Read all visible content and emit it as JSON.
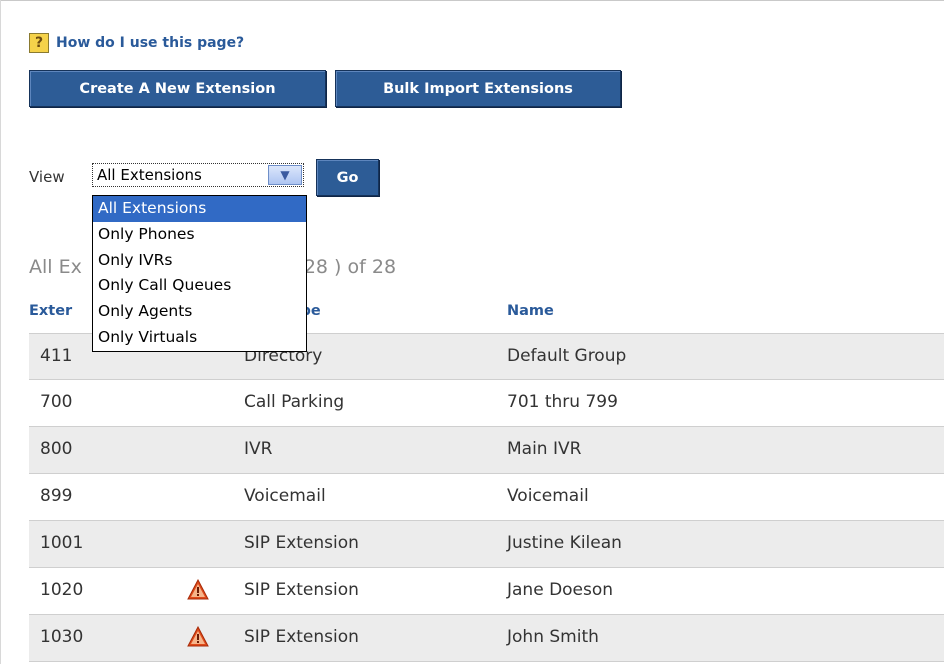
{
  "help": {
    "icon": "help-question-icon",
    "icon_glyph": "?",
    "link_text": "How do I use this page?"
  },
  "toolbar": {
    "create_label": "Create A New Extension",
    "bulk_label": "Bulk Import Extensions"
  },
  "filter": {
    "view_label": "View",
    "selected": "All Extensions",
    "go_label": "Go",
    "options": [
      "All Extensions",
      "Only Phones",
      "Only IVRs",
      "Only Call Queues",
      "Only Agents",
      "Only Virtuals"
    ]
  },
  "summary": {
    "prefix": "All Ex",
    "suffix": "28 ) of 28"
  },
  "table": {
    "headers": {
      "extension": "Exter",
      "type": "sion Type",
      "name": "Name"
    },
    "rows": [
      {
        "extension": "411",
        "warning": false,
        "type": "Directory",
        "name": "Default Group"
      },
      {
        "extension": "700",
        "warning": false,
        "type": "Call Parking",
        "name": "701 thru 799"
      },
      {
        "extension": "800",
        "warning": false,
        "type": "IVR",
        "name": "Main IVR"
      },
      {
        "extension": "899",
        "warning": false,
        "type": "Voicemail",
        "name": "Voicemail"
      },
      {
        "extension": "1001",
        "warning": false,
        "type": "SIP Extension",
        "name": "Justine Kilean"
      },
      {
        "extension": "1020",
        "warning": true,
        "type": "SIP Extension",
        "name": "Jane Doeson"
      },
      {
        "extension": "1030",
        "warning": true,
        "type": "SIP Extension",
        "name": "John Smith"
      }
    ]
  },
  "colors": {
    "button": "#2d5c96",
    "link": "#2a5a9a",
    "row_shade": "#ececec",
    "selection": "#316ac5",
    "warning": "#e04a1a"
  }
}
